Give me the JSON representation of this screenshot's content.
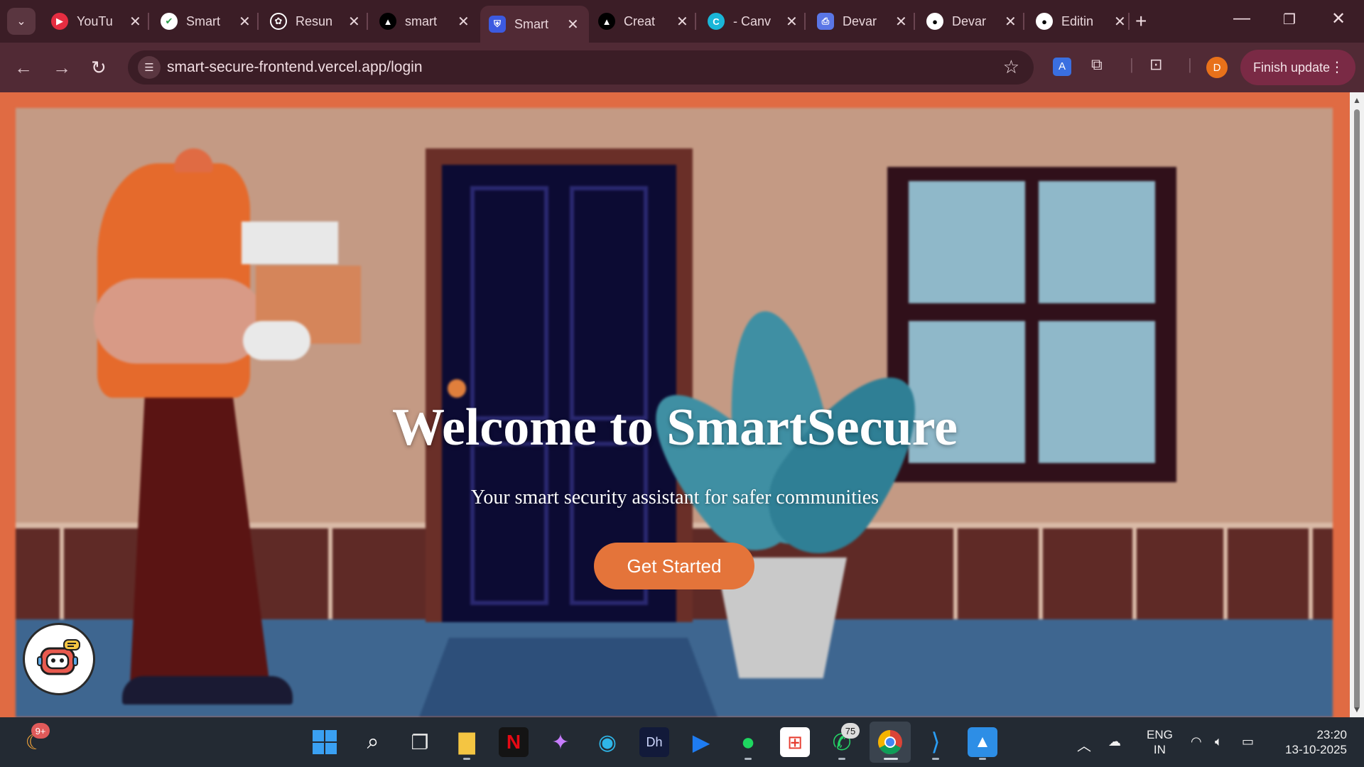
{
  "browser": {
    "tabs": [
      {
        "title": "YouTu",
        "favicon": "youtube-icon",
        "color": "#e52d41"
      },
      {
        "title": "Smart",
        "favicon": "check-shield-icon",
        "color": "#ffffff"
      },
      {
        "title": "Resun",
        "favicon": "openai-icon",
        "color": "#ffffff"
      },
      {
        "title": "smart",
        "favicon": "triangle-icon",
        "color": "#000000"
      },
      {
        "title": "Smart",
        "favicon": "shield-icon",
        "color": "#3c5ae0",
        "active": true
      },
      {
        "title": "Creat",
        "favicon": "triangle-icon",
        "color": "#000000"
      },
      {
        "title": "- Canv",
        "favicon": "canva-icon",
        "color": "#1ab6d8"
      },
      {
        "title": "Devar",
        "favicon": "printer-icon",
        "color": "#5a76e6"
      },
      {
        "title": "Devar",
        "favicon": "github-icon",
        "color": "#ffffff"
      },
      {
        "title": "Editin",
        "favicon": "github-icon",
        "color": "#ffffff"
      }
    ],
    "url": "smart-secure-frontend.vercel.app/login",
    "profile_initial": "D",
    "finish_update_label": "Finish update"
  },
  "page": {
    "hero_title": "Welcome to SmartSecure",
    "hero_subtitle": "Your smart security assistant for safer communities",
    "cta_label": "Get Started",
    "chatbot_icon": "robot-icon",
    "accent_color": "#e4743a"
  },
  "taskbar": {
    "copilot_badge": "9+",
    "whatsapp_badge": "75",
    "lang_line1": "ENG",
    "lang_line2": "IN",
    "time": "23:20",
    "date": "13-10-2025"
  }
}
